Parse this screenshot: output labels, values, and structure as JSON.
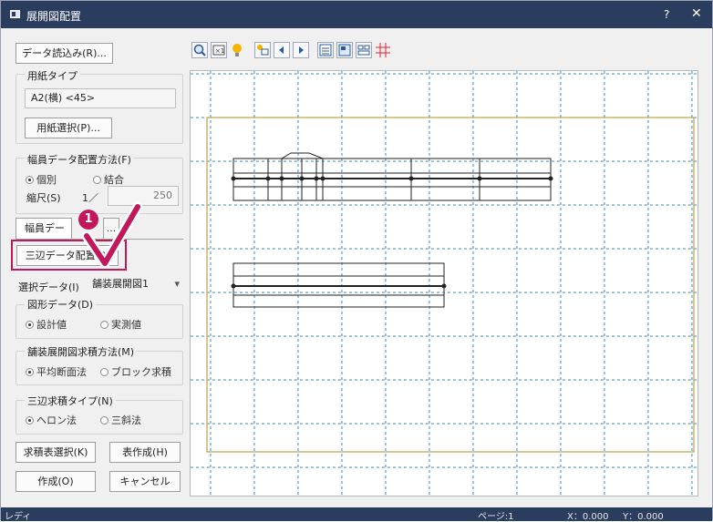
{
  "window": {
    "title": "展開図配置",
    "help": "?",
    "close": "✕"
  },
  "left": {
    "data_read_button": "データ読込み(R)...",
    "paper": {
      "legend": "用紙タイプ",
      "value": "A2(横) <45>",
      "select_button": "用紙選択(P)..."
    },
    "width_method": {
      "legend": "幅員データ配置方法(F)",
      "options": [
        "個別",
        "結合"
      ],
      "selected": "個別",
      "scale_label": "縮尺(S)",
      "scale_prefix": "1／",
      "scale_value": "250"
    },
    "tab_label": "幅員デー",
    "tab_more": "...",
    "marker_number": "1",
    "sankata_button": "三辺データ配置(3)",
    "select_data_label": "選択データ(I)",
    "select_data_value": "舗装展開図1",
    "shape_data": {
      "legend": "図形データ(D)",
      "options": [
        "設計値",
        "実測値"
      ],
      "selected": "設計値"
    },
    "area_method": {
      "legend": "舗装展開図求積方法(M)",
      "options": [
        "平均断面法",
        "ブロック求積"
      ],
      "selected": "平均断面法"
    },
    "sankata_type": {
      "legend": "三辺求積タイプ(N)",
      "options": [
        "ヘロン法",
        "三斜法"
      ],
      "selected": "ヘロン法"
    },
    "buttons": {
      "area_table": "求積表選択(K)",
      "make_table": "表作成(H)",
      "create": "作成(O)",
      "cancel": "キャンセル"
    }
  },
  "toolbar": {
    "icons": [
      "zoom-icon",
      "zoom-fit-icon",
      "light-icon",
      "move-icon",
      "prev-page-icon",
      "next-page-icon",
      "list-icon",
      "layout-icon",
      "align-icon",
      "grid-icon"
    ]
  },
  "status": {
    "left": "レディ",
    "page": "ページ:1",
    "x": "X：0.000",
    "y": "Y：0.000"
  },
  "colors": {
    "titlebar": "#2b3d5e",
    "highlight": "#c2185b",
    "paper_border": "#b8a24a",
    "grid": "#3d8fcf",
    "check": "#c2185b"
  }
}
